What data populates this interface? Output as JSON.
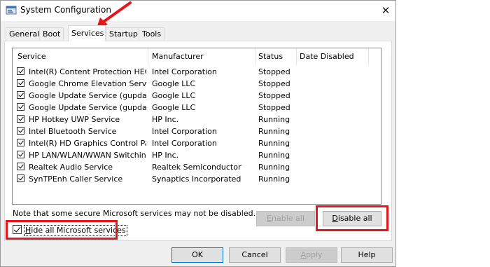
{
  "window": {
    "title": "System Configuration",
    "close_glyph": "✕"
  },
  "tabs": [
    {
      "label": "General",
      "active": false
    },
    {
      "label": "Boot",
      "active": false
    },
    {
      "label": "Services",
      "active": true
    },
    {
      "label": "Startup",
      "active": false
    },
    {
      "label": "Tools",
      "active": false
    }
  ],
  "columns": [
    "Service",
    "Manufacturer",
    "Status",
    "Date Disabled"
  ],
  "services": [
    {
      "checked": true,
      "service": "Intel(R) Content Protection HEC...",
      "manufacturer": "Intel Corporation",
      "status": "Stopped",
      "date_disabled": ""
    },
    {
      "checked": true,
      "service": "Google Chrome Elevation Servic...",
      "manufacturer": "Google LLC",
      "status": "Stopped",
      "date_disabled": ""
    },
    {
      "checked": true,
      "service": "Google Update Service (gupdate)",
      "manufacturer": "Google LLC",
      "status": "Stopped",
      "date_disabled": ""
    },
    {
      "checked": true,
      "service": "Google Update Service (gupdatem)",
      "manufacturer": "Google LLC",
      "status": "Stopped",
      "date_disabled": ""
    },
    {
      "checked": true,
      "service": "HP Hotkey UWP Service",
      "manufacturer": "HP Inc.",
      "status": "Running",
      "date_disabled": ""
    },
    {
      "checked": true,
      "service": "Intel Bluetooth Service",
      "manufacturer": "Intel Corporation",
      "status": "Running",
      "date_disabled": ""
    },
    {
      "checked": true,
      "service": "Intel(R) HD Graphics Control Pa...",
      "manufacturer": "Intel Corporation",
      "status": "Running",
      "date_disabled": ""
    },
    {
      "checked": true,
      "service": "HP LAN/WLAN/WWAN Switching...",
      "manufacturer": "HP Inc.",
      "status": "Running",
      "date_disabled": ""
    },
    {
      "checked": true,
      "service": "Realtek Audio Service",
      "manufacturer": "Realtek Semiconductor",
      "status": "Running",
      "date_disabled": ""
    },
    {
      "checked": true,
      "service": "SynTPEnh Caller Service",
      "manufacturer": "Synaptics Incorporated",
      "status": "Running",
      "date_disabled": ""
    }
  ],
  "note": "Note that some secure Microsoft services may not be disabled.",
  "enable_all": {
    "pre": "",
    "accel": "E",
    "post": "nable all"
  },
  "disable_all": {
    "pre": "",
    "accel": "D",
    "post": "isable all"
  },
  "hide_ms": {
    "checked": true,
    "pre": "",
    "accel": "H",
    "post": "ide all Microsoft services"
  },
  "footer": {
    "ok": "OK",
    "cancel": "Cancel",
    "apply": {
      "pre": "",
      "accel": "A",
      "post": "pply"
    },
    "help": "Help"
  },
  "colors": {
    "annotation_red": "#e5161b",
    "focus_blue": "#0078d7"
  }
}
